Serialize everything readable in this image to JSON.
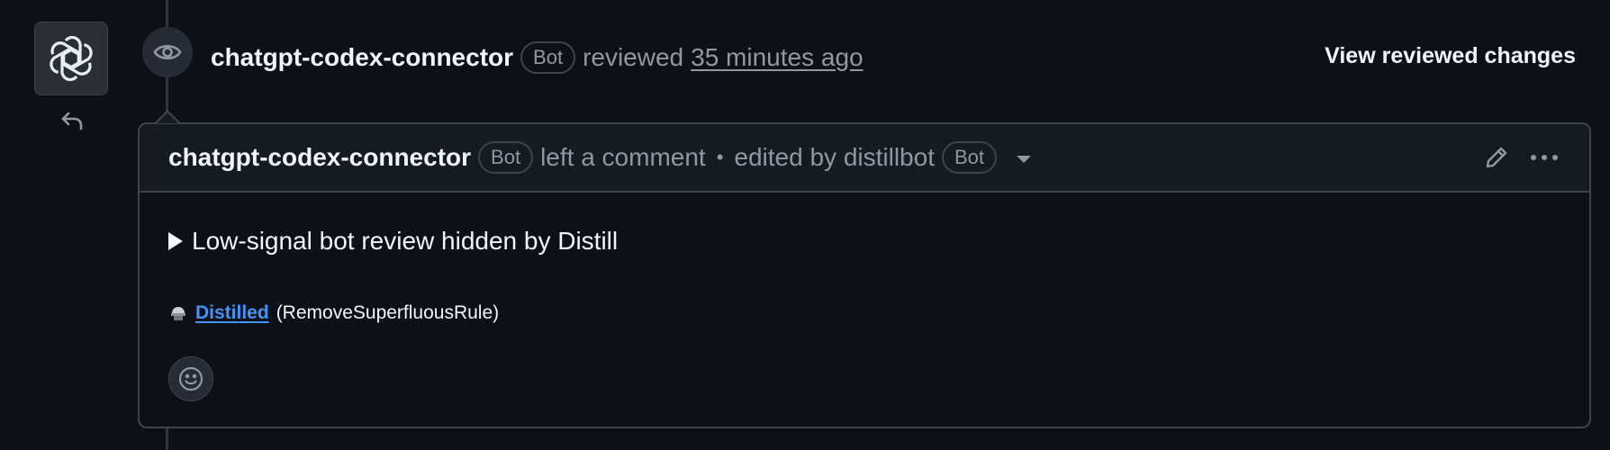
{
  "review": {
    "author": "chatgpt-codex-connector",
    "author_badge": "Bot",
    "action": "reviewed",
    "time": "35 minutes ago",
    "view_changes_label": "View reviewed changes"
  },
  "comment": {
    "author": "chatgpt-codex-connector",
    "author_badge": "Bot",
    "action": "left a comment",
    "separator": "•",
    "edited_by": "edited by distillbot",
    "editor_badge": "Bot",
    "summary": "Low-signal bot review hidden by Distill",
    "distilled_link": "Distilled",
    "distilled_rule": "(RemoveSuperfluousRule)"
  },
  "icons": {
    "avatar": "openai-logo-icon",
    "reply": "reply-arrow-icon",
    "review_state": "eye-icon",
    "edit": "pencil-icon",
    "more": "kebab-horizontal-icon",
    "distilled": "distill-flask-icon",
    "reaction": "smiley-icon",
    "details": "triangle-right-icon",
    "dropdown": "triangle-down-icon"
  },
  "colors": {
    "background": "#0d1117",
    "header_background": "#151b23",
    "border": "#3d444d",
    "muted_text": "#9198a1",
    "link": "#4493f8"
  }
}
